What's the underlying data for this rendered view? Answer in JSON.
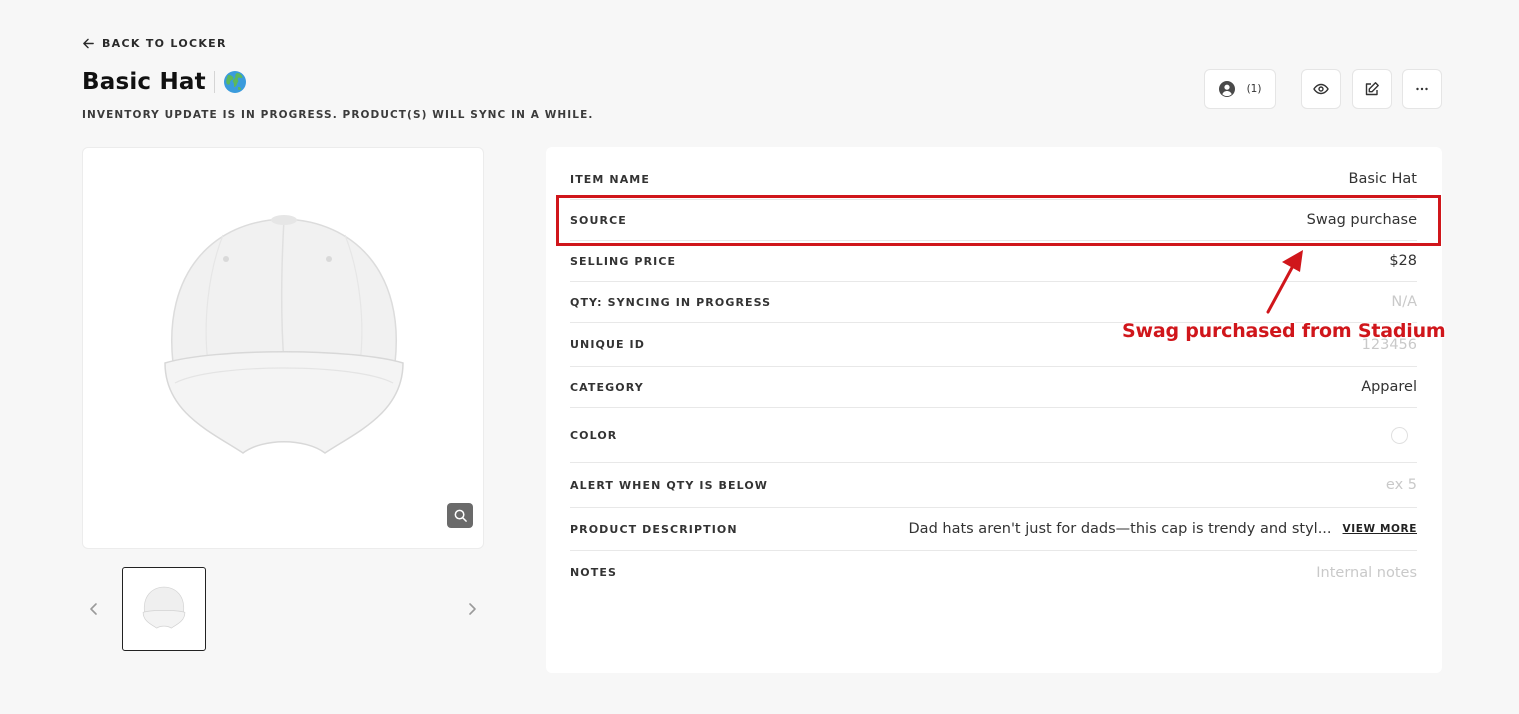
{
  "header": {
    "back_label": "BACK TO LOCKER",
    "title": "Basic Hat",
    "sync_notice": "INVENTORY UPDATE IS IN PROGRESS. PRODUCT(S) WILL SYNC IN A WHILE."
  },
  "actions": {
    "owners_count": "(1)"
  },
  "details": {
    "item_name": {
      "label": "ITEM NAME",
      "value": "Basic Hat"
    },
    "source": {
      "label": "SOURCE",
      "value": "Swag purchase"
    },
    "selling_price": {
      "label": "SELLING PRICE",
      "value": "$28"
    },
    "qty": {
      "label": "QTY: SYNCING IN PROGRESS",
      "value": "N/A"
    },
    "unique_id": {
      "label": "UNIQUE ID",
      "value": "123456"
    },
    "category": {
      "label": "CATEGORY",
      "value": "Apparel"
    },
    "color": {
      "label": "COLOR",
      "value": "#ffffff"
    },
    "alert_qty": {
      "label": "ALERT WHEN QTY IS BELOW",
      "placeholder": "ex 5"
    },
    "description": {
      "label": "PRODUCT DESCRIPTION",
      "value": "Dad hats aren't just for dads—this cap is trendy and styl...",
      "view_more": "VIEW MORE"
    },
    "notes": {
      "label": "NOTES",
      "placeholder": "Internal notes"
    }
  },
  "annotation": {
    "text": "Swag purchased from Stadium",
    "color": "#d0161b"
  }
}
